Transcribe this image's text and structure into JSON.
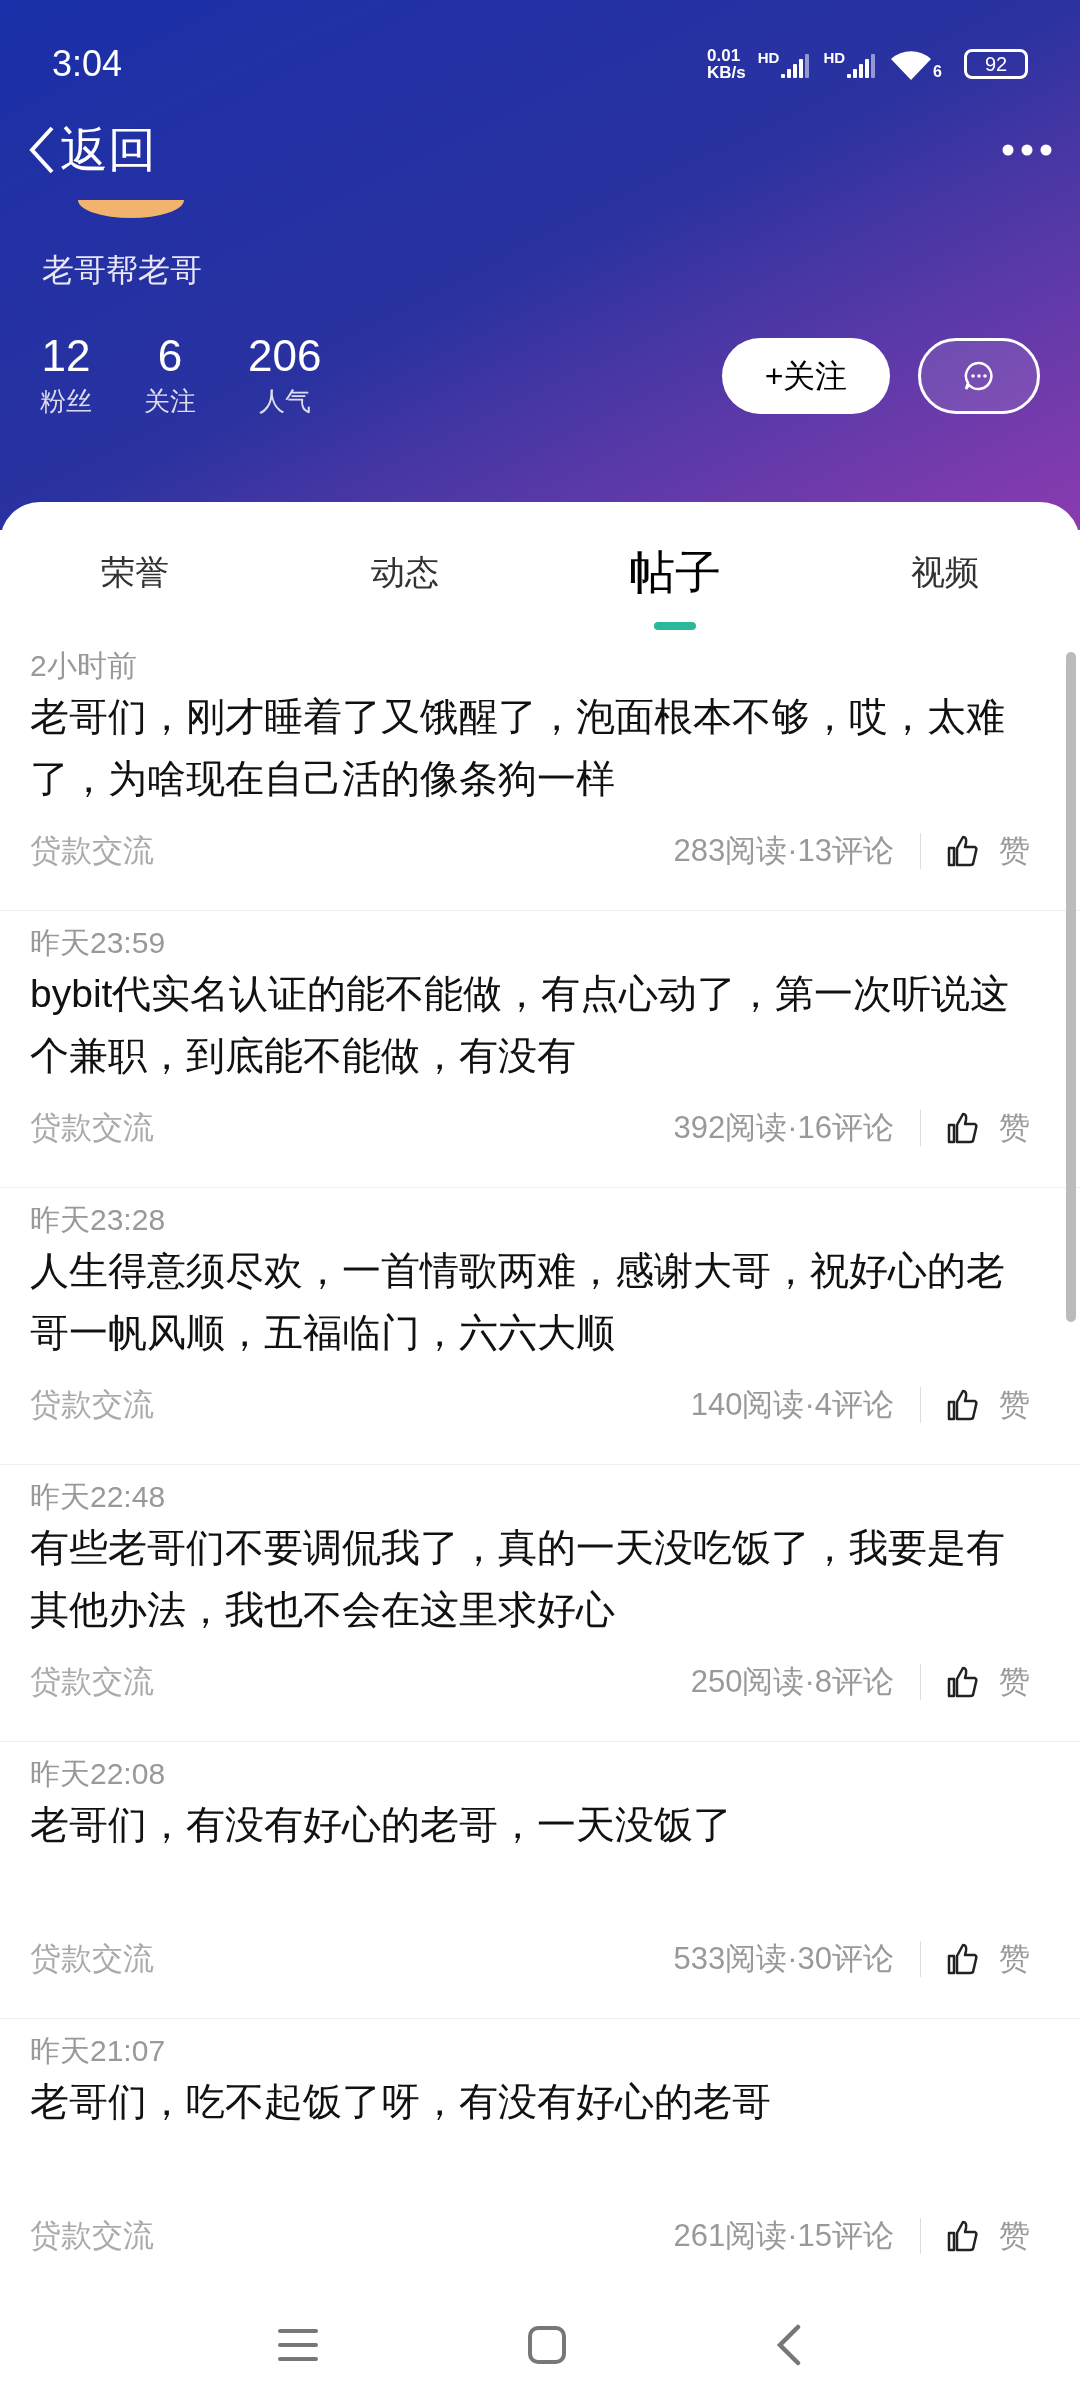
{
  "status_bar": {
    "time": "3:04",
    "net_speed": "0.01",
    "net_unit": "KB/s",
    "sims": [
      "HD",
      "HD"
    ],
    "wifi_label": "6",
    "battery": "92"
  },
  "header": {
    "back_label": "返回",
    "user_name": "老哥帮老哥",
    "stats": [
      {
        "value": "12",
        "label": "粉丝"
      },
      {
        "value": "6",
        "label": "关注"
      },
      {
        "value": "206",
        "label": "人气"
      }
    ],
    "follow_button": "+关注"
  },
  "tabs": [
    {
      "label": "荣誉",
      "selected": false
    },
    {
      "label": "动态",
      "selected": false
    },
    {
      "label": "帖子",
      "selected": true
    },
    {
      "label": "视频",
      "selected": false
    }
  ],
  "posts": [
    {
      "time": "2小时前",
      "title": "老哥们，刚才睡着了又饿醒了，泡面根本不够，哎，太难了，为啥现在自己活的像条狗一样",
      "category": "贷款交流",
      "stats": "283阅读·13评论",
      "like": "赞"
    },
    {
      "time": "昨天23:59",
      "title": "bybit代实名认证的能不能做，有点心动了，第一次听说这个兼职，到底能不能做，有没有",
      "category": "贷款交流",
      "stats": "392阅读·16评论",
      "like": "赞"
    },
    {
      "time": "昨天23:28",
      "title": "人生得意须尽欢，一首情歌两难，感谢大哥，祝好心的老哥一帆风顺，五福临门，六六大顺",
      "category": "贷款交流",
      "stats": "140阅读·4评论",
      "like": "赞"
    },
    {
      "time": "昨天22:48",
      "title": "有些老哥们不要调侃我了，真的一天没吃饭了，我要是有其他办法，我也不会在这里求好心",
      "category": "贷款交流",
      "stats": "250阅读·8评论",
      "like": "赞"
    },
    {
      "time": "昨天22:08",
      "title": "老哥们，有没有好心的老哥，一天没饭了",
      "category": "贷款交流",
      "stats": "533阅读·30评论",
      "like": "赞"
    },
    {
      "time": "昨天21:07",
      "title": "老哥们，吃不起饭了呀，有没有好心的老哥",
      "category": "贷款交流",
      "stats": "261阅读·15评论",
      "like": "赞"
    }
  ]
}
